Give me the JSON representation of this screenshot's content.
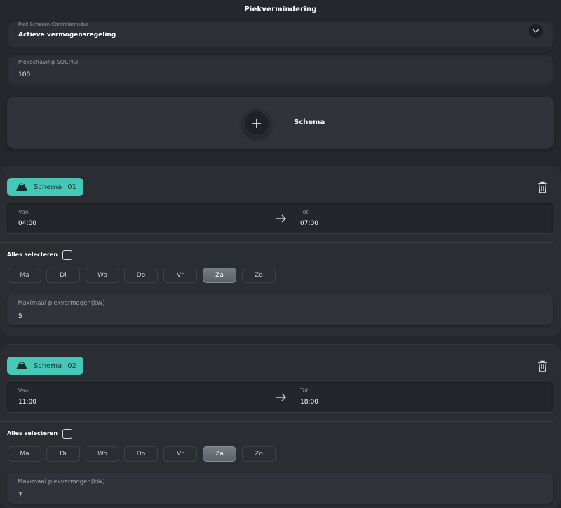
{
  "header": {
    "title": "Piekvermindering"
  },
  "control_mode": {
    "label": "Piek Scheren Controlemodus",
    "value": "Actieve vermogensregeling"
  },
  "soc": {
    "label": "Piekschaving SOC(%)",
    "value": "100"
  },
  "add_schedule": {
    "label": "Schema"
  },
  "select_all_label": "Alles selecteren",
  "days": [
    "Ma",
    "Di",
    "Wo",
    "Do",
    "Vr",
    "Za",
    "Zo"
  ],
  "schedules": [
    {
      "badge_label": "Schema",
      "number": "01",
      "from_label": "Van",
      "from": "04:00",
      "to_label": "Tot",
      "to": "07:00",
      "selected_day": "Za",
      "power_label": "Maximaal piekvermogen(kW)",
      "power": "5"
    },
    {
      "badge_label": "Schema",
      "number": "02",
      "from_label": "Van",
      "from": "11:00",
      "to_label": "Tot",
      "to": "18:00",
      "selected_day": "Za",
      "power_label": "Maximaal piekvermogen(kW)",
      "power": "7"
    }
  ],
  "colors": {
    "accent": "#46c8b8",
    "background": "#24272c",
    "card": "#2c3036"
  },
  "icons": {
    "dropdown": "chevron-down-icon",
    "add": "plus-icon",
    "delete": "trash-icon",
    "range": "arrow-right-icon",
    "badge": "schedule-badge-icon"
  }
}
